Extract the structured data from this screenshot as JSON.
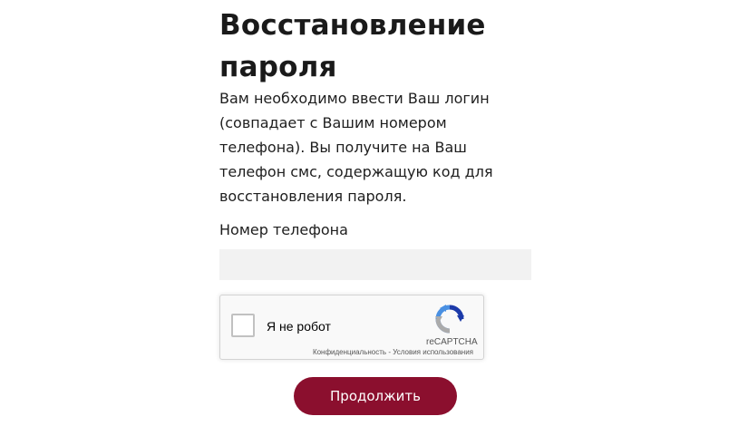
{
  "page": {
    "title": "Восстановление пароля",
    "description": "Вам необходимо ввести Ваш логин (совпадает с Вашим номером телефона). Вы получите на Ваш телефон смс, содержащую код для восстановления пароля."
  },
  "form": {
    "phone_label": "Номер телефона",
    "phone_value": "",
    "phone_placeholder": "",
    "submit_label": "Продолжить",
    "submit_color": "#8b0f2e"
  },
  "recaptcha": {
    "checkbox_label": "Я не робот",
    "checked": false,
    "brand": "reCAPTCHA",
    "privacy_link": "Конфиденциальность",
    "separator": " - ",
    "terms_link": "Условия использования",
    "logo_icon": "recaptcha-logo-icon"
  }
}
